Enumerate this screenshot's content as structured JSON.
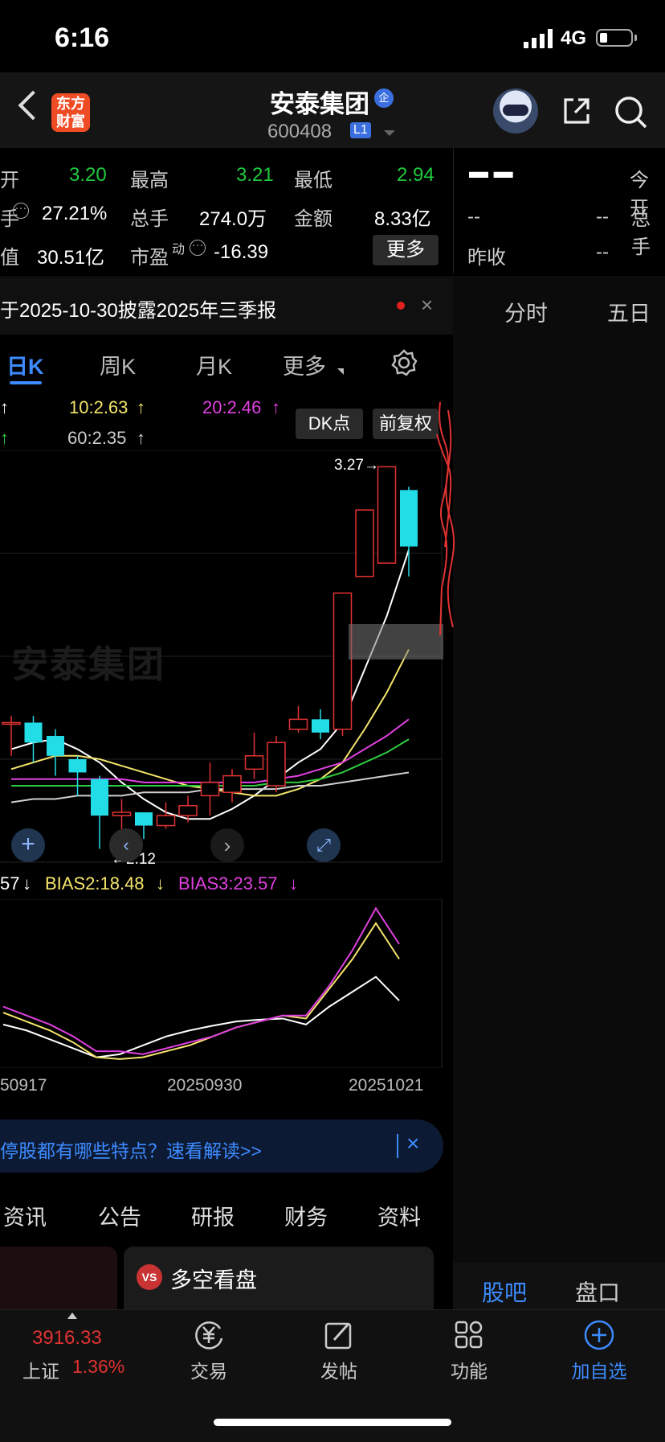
{
  "status_bar": {
    "time": "6:16",
    "network": "4G"
  },
  "header": {
    "logo_text": "东方\n财富",
    "stock_name": "安泰集团",
    "name_badge": "企",
    "stock_code": "600408",
    "level_badge": "L1"
  },
  "quote": {
    "row1": {
      "l1": "开",
      "v1": "3.20",
      "l2": "最高",
      "v2": "3.21",
      "l3": "最低",
      "v3": "2.94"
    },
    "row2": {
      "l1": "手",
      "v1": "27.21%",
      "l2": "总手",
      "v2": "274.0万",
      "l3": "金额",
      "v3": "8.33亿"
    },
    "row3": {
      "l1": "值",
      "v1": "30.51亿",
      "l2": "市盈",
      "l2_sup": "动",
      "v2": "-16.39",
      "more": "更多"
    },
    "right": {
      "dash_big": "▬ ▬",
      "today_open": "今开",
      "total": "总手",
      "prev_close": "昨收",
      "dash": "--"
    }
  },
  "announcement": {
    "text": "于2025-10-30披露2025年三季报",
    "close": "×"
  },
  "period_tabs": [
    {
      "label": "日K",
      "active": true
    },
    {
      "label": "周K"
    },
    {
      "label": "月K"
    },
    {
      "label": "更多"
    }
  ],
  "right_tabs": [
    "分时",
    "五日"
  ],
  "ma_legend": {
    "ma5_arrow": "↑",
    "ma10": "10:2.63",
    "ma10_arrow": "↑",
    "ma20": "20:2.46",
    "ma20_arrow": "↑",
    "ma30_arrow": "↑",
    "ma60": "60:2.35",
    "ma60_arrow": "↑"
  },
  "buttons": {
    "dk": "DK点",
    "fq": "前复权"
  },
  "chart_labels": {
    "high": "3.27→",
    "low": "←2.12"
  },
  "bias_legend": {
    "b1": "57",
    "b1_arrow": "↓",
    "b2": "BIAS2:18.48",
    "b2_arrow": "↓",
    "b3": "BIAS3:23.57",
    "b3_arrow": "↓"
  },
  "dates": [
    "50917",
    "20250930",
    "20251021"
  ],
  "hint": {
    "text": "停股都有哪些特点？速看解读>>",
    "close": "×"
  },
  "news_tabs": [
    "资讯",
    "公告",
    "研报",
    "财务",
    "资料"
  ],
  "card": {
    "badge": "VS",
    "title": "多空看盘"
  },
  "right_bottom_tabs": [
    {
      "label": "股吧",
      "active": true
    },
    {
      "label": "盘口"
    }
  ],
  "bottom_nav": {
    "index_value": "3916.33",
    "index_name": "上证",
    "index_pct": "1.36%",
    "items": [
      "交易",
      "发帖",
      "功能",
      "加自选"
    ]
  },
  "colors": {
    "up": "#e23232",
    "down": "#22dce6",
    "accent": "#3d8bff",
    "low_green": "#1ecb3e"
  },
  "chart_data": {
    "type": "candlestick",
    "y_axis_labels_shown": [
      "3.27",
      "2.12"
    ],
    "candles": [
      {
        "o": 2.5,
        "c": 2.5,
        "h": 2.52,
        "l": 2.4
      },
      {
        "o": 2.5,
        "c": 2.44,
        "h": 2.52,
        "l": 2.38
      },
      {
        "o": 2.46,
        "c": 2.4,
        "h": 2.48,
        "l": 2.34
      },
      {
        "o": 2.39,
        "c": 2.35,
        "h": 2.4,
        "l": 2.28
      },
      {
        "o": 2.33,
        "c": 2.22,
        "h": 2.34,
        "l": 2.12
      },
      {
        "o": 2.22,
        "c": 2.23,
        "h": 2.27,
        "l": 2.16
      },
      {
        "o": 2.23,
        "c": 2.19,
        "h": 2.23,
        "l": 2.15
      },
      {
        "o": 2.19,
        "c": 2.22,
        "h": 2.26,
        "l": 2.18
      },
      {
        "o": 2.22,
        "c": 2.25,
        "h": 2.28,
        "l": 2.2
      },
      {
        "o": 2.28,
        "c": 2.32,
        "h": 2.38,
        "l": 2.22
      },
      {
        "o": 2.29,
        "c": 2.34,
        "h": 2.36,
        "l": 2.26
      },
      {
        "o": 2.36,
        "c": 2.4,
        "h": 2.47,
        "l": 2.33
      },
      {
        "o": 2.31,
        "c": 2.44,
        "h": 2.46,
        "l": 2.29
      },
      {
        "o": 2.48,
        "c": 2.51,
        "h": 2.55,
        "l": 2.47
      },
      {
        "o": 2.51,
        "c": 2.47,
        "h": 2.54,
        "l": 2.45
      },
      {
        "o": 2.48,
        "c": 2.89,
        "h": 2.89,
        "l": 2.46
      },
      {
        "o": 2.94,
        "c": 3.14,
        "h": 3.14,
        "l": 2.94
      },
      {
        "o": 2.98,
        "c": 3.27,
        "h": 3.27,
        "l": 2.98
      },
      {
        "o": 3.2,
        "c": 3.03,
        "h": 3.21,
        "l": 2.94
      }
    ],
    "ma_series": [
      {
        "name": "MA5",
        "color": "#ffffff",
        "values": [
          2.42,
          2.44,
          2.45,
          2.42,
          2.38,
          2.32,
          2.27,
          2.23,
          2.21,
          2.21,
          2.24,
          2.28,
          2.33,
          2.38,
          2.42,
          2.5,
          2.66,
          2.82,
          3.02
        ]
      },
      {
        "name": "MA10",
        "color": "#f5e56b",
        "values": [
          2.36,
          2.38,
          2.4,
          2.4,
          2.39,
          2.37,
          2.35,
          2.33,
          2.31,
          2.3,
          2.29,
          2.28,
          2.28,
          2.3,
          2.33,
          2.38,
          2.48,
          2.59,
          2.72
        ]
      },
      {
        "name": "MA20",
        "color": "#e040e0",
        "values": [
          2.33,
          2.33,
          2.33,
          2.33,
          2.33,
          2.33,
          2.32,
          2.32,
          2.32,
          2.32,
          2.32,
          2.32,
          2.33,
          2.34,
          2.36,
          2.38,
          2.42,
          2.46,
          2.51
        ]
      },
      {
        "name": "MA30",
        "color": "#2ecc40",
        "values": [
          2.31,
          2.31,
          2.31,
          2.31,
          2.31,
          2.31,
          2.31,
          2.31,
          2.31,
          2.31,
          2.31,
          2.31,
          2.32,
          2.32,
          2.33,
          2.35,
          2.38,
          2.41,
          2.45
        ]
      },
      {
        "name": "MA60",
        "color": "#cfcfcf",
        "values": [
          2.26,
          2.27,
          2.27,
          2.28,
          2.28,
          2.28,
          2.29,
          2.29,
          2.29,
          2.3,
          2.3,
          2.3,
          2.3,
          2.31,
          2.31,
          2.32,
          2.33,
          2.34,
          2.35
        ]
      }
    ],
    "bias_series": [
      {
        "name": "BIAS1",
        "color": "#ffffff",
        "values": [
          -2.0,
          -3.0,
          -4.5,
          -6.0,
          -7.5,
          -7.0,
          -5.5,
          -4.0,
          -3.0,
          -2.2,
          -1.5,
          -1.2,
          -1.0,
          -2.0,
          1.0,
          3.5,
          6.0,
          2.0
        ]
      },
      {
        "name": "BIAS2",
        "color": "#f5e56b",
        "values": [
          0.0,
          -1.5,
          -3.0,
          -5.0,
          -7.5,
          -7.8,
          -7.5,
          -6.5,
          -5.5,
          -4.0,
          -2.5,
          -1.5,
          -0.5,
          -1.0,
          4.0,
          9.0,
          15.0,
          9.0
        ]
      },
      {
        "name": "BIAS3",
        "color": "#e040e0",
        "values": [
          1.0,
          -0.5,
          -2.0,
          -4.0,
          -6.5,
          -6.5,
          -7.0,
          -6.0,
          -5.0,
          -4.0,
          -2.5,
          -1.5,
          -0.5,
          -0.5,
          4.5,
          10.5,
          17.5,
          11.5
        ]
      }
    ]
  }
}
